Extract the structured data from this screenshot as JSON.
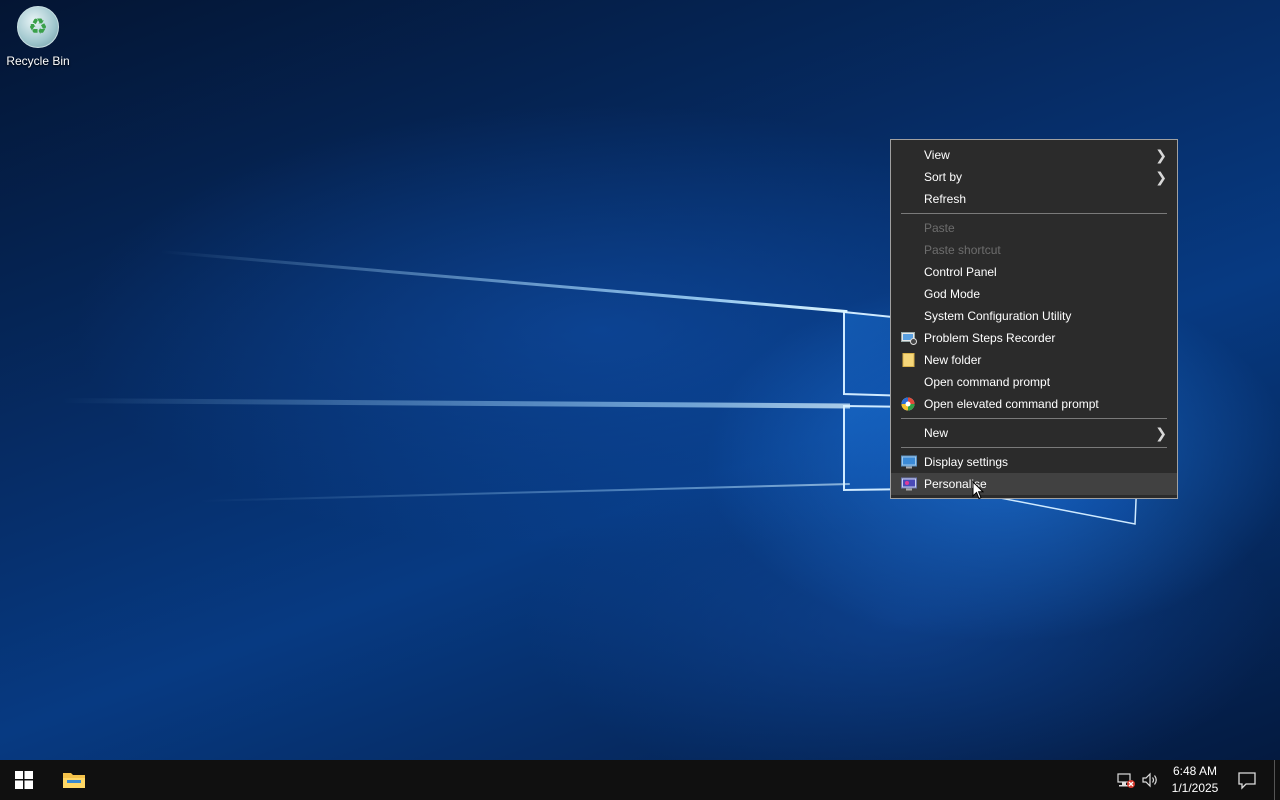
{
  "desktop": {
    "icons": [
      {
        "label": "Recycle Bin",
        "icon": "recycle-bin-icon"
      }
    ]
  },
  "context_menu": {
    "groups": [
      [
        {
          "label": "View",
          "submenu": true,
          "disabled": false
        },
        {
          "label": "Sort by",
          "submenu": true,
          "disabled": false
        },
        {
          "label": "Refresh",
          "submenu": false,
          "disabled": false
        }
      ],
      [
        {
          "label": "Paste",
          "disabled": true
        },
        {
          "label": "Paste shortcut",
          "disabled": true
        },
        {
          "label": "Control Panel",
          "disabled": false
        },
        {
          "label": "God Mode",
          "disabled": false
        },
        {
          "label": "System Configuration Utility",
          "disabled": false
        },
        {
          "label": "Problem Steps Recorder",
          "icon": "steps-recorder-icon",
          "disabled": false
        },
        {
          "label": "New folder",
          "icon": "folder-icon",
          "disabled": false
        },
        {
          "label": "Open command prompt",
          "disabled": false
        },
        {
          "label": "Open elevated command prompt",
          "icon": "shield-icon",
          "disabled": false
        }
      ],
      [
        {
          "label": "New",
          "submenu": true,
          "disabled": false
        }
      ],
      [
        {
          "label": "Display settings",
          "icon": "display-icon",
          "disabled": false
        },
        {
          "label": "Personalise",
          "icon": "personalise-icon",
          "disabled": false,
          "hover": true
        }
      ]
    ]
  },
  "taskbar": {
    "start_icon": "windows-start-icon",
    "pinned": [
      "file-explorer-icon"
    ],
    "tray": {
      "icons": [
        "network-disconnected-icon",
        "volume-icon",
        "notification-icon"
      ],
      "time": "6:48 AM",
      "date": "1/1/2025"
    }
  },
  "colors": {
    "menu_bg": "#2b2b2b",
    "menu_hover": "#414141",
    "taskbar_bg": "#101010"
  }
}
